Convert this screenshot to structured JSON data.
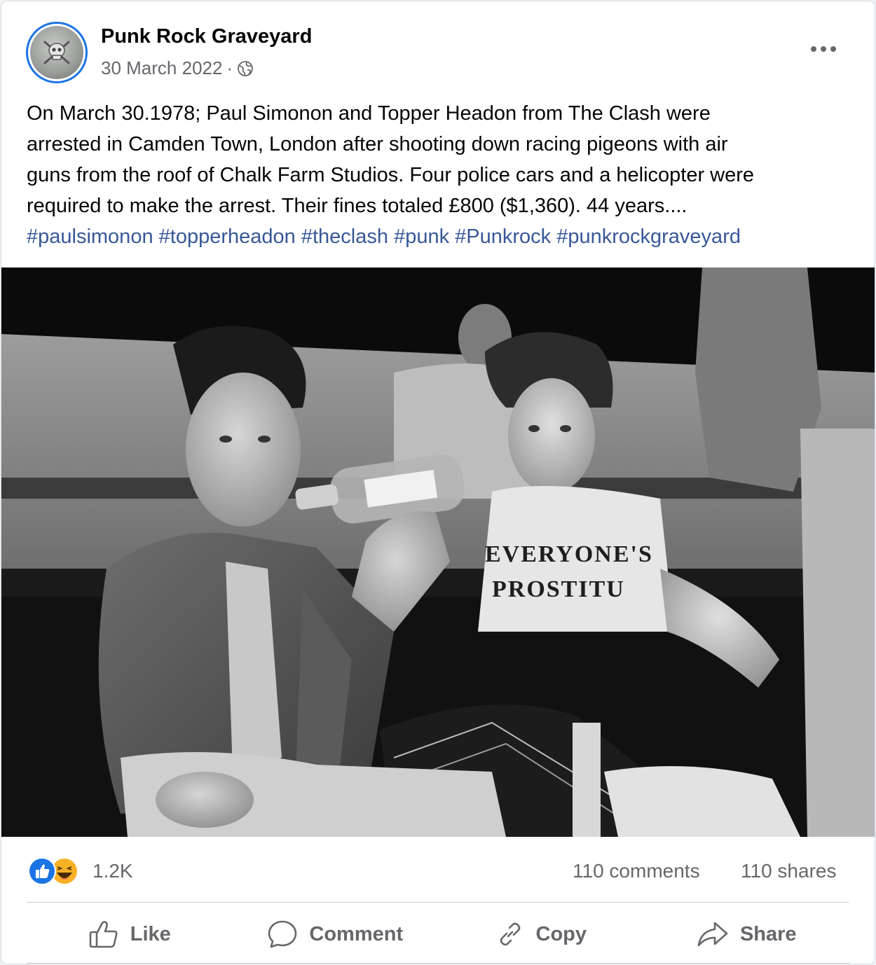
{
  "post": {
    "page_name": "Punk Rock Graveyard",
    "date": "30 March 2022",
    "separator": "·",
    "audience_icon": "globe-icon",
    "more_icon": "more-options-icon",
    "body_lines": [
      "On March 30.1978; Paul Simonon and Topper Headon from The Clash were",
      "arrested in Camden Town, London after shooting down racing pigeons with air",
      "guns from the roof of Chalk Farm Studios. Four police cars and a helicopter were",
      "required to make the arrest. Their fines totaled £800 ($1,360). 44 years...."
    ],
    "hashtags": [
      "#paulsimonon",
      "#topperheadon",
      "#theclash",
      "#punk",
      "#Punkrock",
      "#punkrockgraveyard"
    ],
    "photo": {
      "shirt_line1": "EVERYONE'S",
      "shirt_line2": "PROSTITU"
    }
  },
  "stats": {
    "reactions": [
      "like-reaction-icon",
      "haha-reaction-icon"
    ],
    "reaction_count": "1.2K",
    "comments": "110 comments",
    "shares": "110 shares"
  },
  "actions": [
    {
      "label": "Like",
      "icon": "like-icon"
    },
    {
      "label": "Comment",
      "icon": "comment-icon"
    },
    {
      "label": "Copy",
      "icon": "link-icon"
    },
    {
      "label": "Share",
      "icon": "share-icon"
    }
  ],
  "colors": {
    "like_blue": "#1b74e4",
    "hashtag": "#385898",
    "secondary_text": "#65676b",
    "haha_yellow": "#f7b125"
  }
}
